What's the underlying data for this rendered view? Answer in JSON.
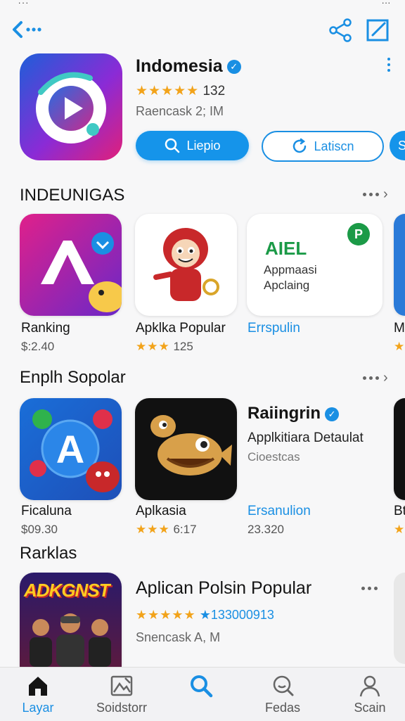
{
  "status": {
    "left": "...",
    "right": "..."
  },
  "header": {
    "back_icon": "back-arrow-icon",
    "share_icon": "share-icon",
    "edit_icon": "edit-icon"
  },
  "hero": {
    "title": "Indomesia",
    "rating_count": "132",
    "subtitle": "Raencask 2; IM",
    "primary_button": "Liepio",
    "secondary_button": "Latiscn",
    "third_button": "S"
  },
  "section1": {
    "title": "INDEUNIGAS",
    "cards": [
      {
        "title": "Ranking",
        "meta": "$:2.40"
      },
      {
        "title": "Apklka Popular",
        "meta": "125"
      },
      {
        "title": "Errspulin",
        "meta": "",
        "icon_heading": "AIEL",
        "icon_line1": "Appmaasi",
        "icon_line2": "Apclaing"
      },
      {
        "title": "M",
        "meta": ""
      }
    ]
  },
  "section2": {
    "title": "Enplh Sopolar",
    "cards": [
      {
        "title": "Ficaluna",
        "meta": "$09.30"
      },
      {
        "title": "Aplkasia",
        "meta": "6:17"
      },
      {
        "title": "Ersanulion",
        "meta": "23.320"
      },
      {
        "title": "Bt",
        "meta": ""
      }
    ],
    "feature": {
      "title": "Raiingrin",
      "line1": "Applkitiara Detaulat",
      "line2": "Cioestcas"
    }
  },
  "section3": {
    "title": "Rarklas",
    "item": {
      "title": "Aplican Polsin Popular",
      "rating_text": "133000913",
      "subtitle": "Snencask A, M",
      "banner": "ADKGNST"
    }
  },
  "bottom_nav": [
    {
      "label": "Layar",
      "icon": "home-icon",
      "active": true
    },
    {
      "label": "Soidstorr",
      "icon": "image-icon",
      "active": false
    },
    {
      "label": "",
      "icon": "search-icon",
      "active": false
    },
    {
      "label": "Fedas",
      "icon": "chat-search-icon",
      "active": false
    },
    {
      "label": "Scain",
      "icon": "profile-icon",
      "active": false
    }
  ],
  "colors": {
    "accent": "#1594ea",
    "star": "#f2a31a"
  }
}
